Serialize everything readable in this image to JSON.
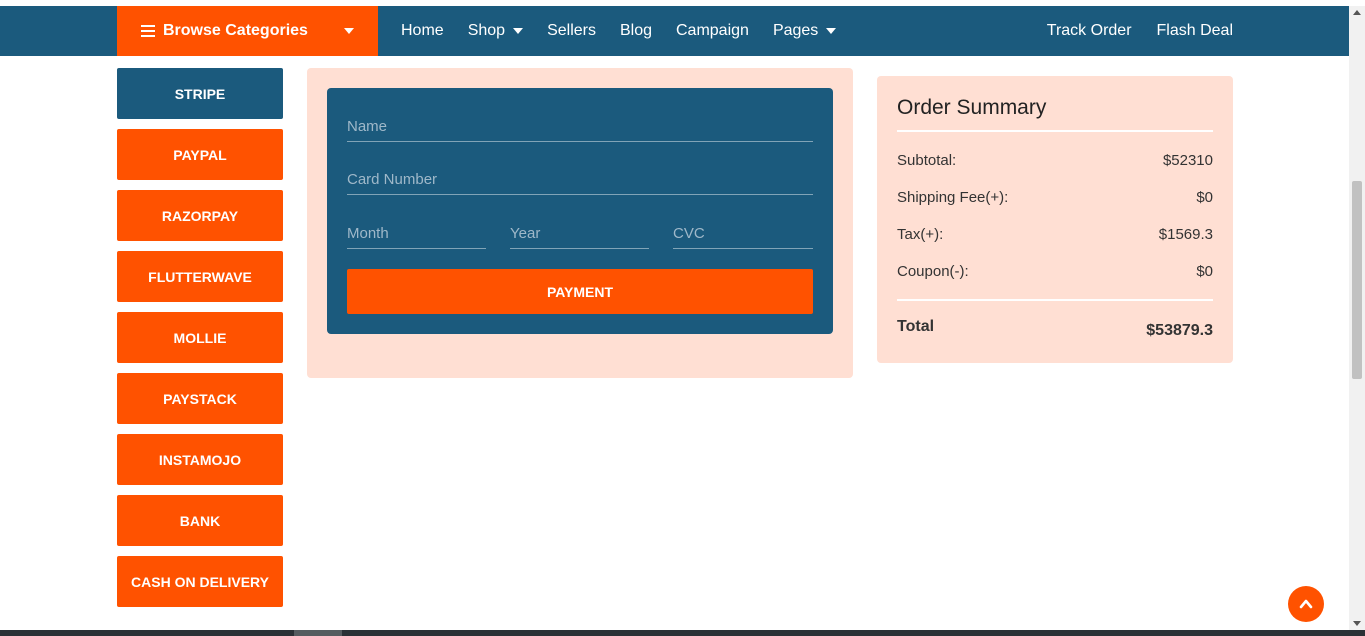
{
  "navbar": {
    "browse_label": "Browse Categories",
    "links": [
      {
        "label": "Home",
        "dropdown": false
      },
      {
        "label": "Shop",
        "dropdown": true
      },
      {
        "label": "Sellers",
        "dropdown": false
      },
      {
        "label": "Blog",
        "dropdown": false
      },
      {
        "label": "Campaign",
        "dropdown": false
      },
      {
        "label": "Pages",
        "dropdown": true
      }
    ],
    "right_links": [
      "Track Order",
      "Flash Deal"
    ]
  },
  "payment_methods": [
    {
      "label": "STRIPE",
      "active": true
    },
    {
      "label": "PAYPAL",
      "active": false
    },
    {
      "label": "RAZORPAY",
      "active": false
    },
    {
      "label": "FLUTTERWAVE",
      "active": false
    },
    {
      "label": "MOLLIE",
      "active": false
    },
    {
      "label": "PAYSTACK",
      "active": false
    },
    {
      "label": "INSTAMOJO",
      "active": false
    },
    {
      "label": "BANK",
      "active": false
    },
    {
      "label": "CASH ON DELIVERY",
      "active": false
    }
  ],
  "card_form": {
    "name_placeholder": "Name",
    "card_number_placeholder": "Card Number",
    "month_placeholder": "Month",
    "year_placeholder": "Year",
    "cvc_placeholder": "CVC",
    "submit_label": "PAYMENT"
  },
  "order_summary": {
    "title": "Order Summary",
    "rows": [
      {
        "label": "Subtotal:",
        "value": "$52310"
      },
      {
        "label": "Shipping Fee(+):",
        "value": "$0"
      },
      {
        "label": "Tax(+):",
        "value": "$1569.3"
      },
      {
        "label": "Coupon(-):",
        "value": "$0"
      }
    ],
    "total_label": "Total",
    "total_value": "$53879.3"
  },
  "colors": {
    "primary_blue": "#1b5a7d",
    "accent_orange": "#ff5200",
    "panel_peach": "#ffdfd3"
  },
  "icons": {
    "browse": "hamburger-icon",
    "dropdown": "caret-down-icon",
    "scroll_top": "chevron-up-icon"
  }
}
